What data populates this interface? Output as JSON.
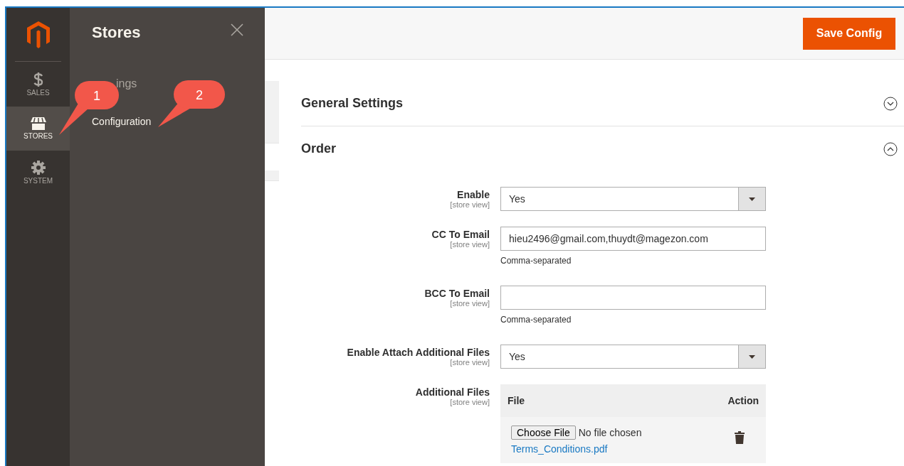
{
  "nav": {
    "items": [
      {
        "kind": "dollar",
        "label": "SALES",
        "selected": false
      },
      {
        "kind": "store",
        "label": "STORES",
        "selected": true
      },
      {
        "kind": "gear",
        "label": "SYSTEM",
        "selected": false
      }
    ]
  },
  "flyout": {
    "title": "Stores",
    "items": [
      "ings",
      "Configuration"
    ]
  },
  "callouts": [
    "1",
    "2"
  ],
  "toolbar": {
    "button": "Save Config"
  },
  "sections": [
    {
      "title": "General Settings",
      "expanded": false
    },
    {
      "title": "Order",
      "expanded": true
    }
  ],
  "fields": [
    {
      "kind": "select",
      "label": "Enable",
      "scope": "[store view]",
      "value": "Yes"
    },
    {
      "kind": "text",
      "label": "CC To Email",
      "scope": "[store view]",
      "value": "hieu2496@gmail.com,thuydt@magezon.com",
      "note": "Comma-separated"
    },
    {
      "kind": "text",
      "label": "BCC To Email",
      "scope": "[store view]",
      "note": "Comma-separated"
    },
    {
      "kind": "select",
      "label": "Enable Attach Additional Files",
      "scope": "[store view]",
      "value": "Yes"
    },
    {
      "kind": "files",
      "label": "Additional Files",
      "scope": "[store view]",
      "columns": [
        "File",
        "Action"
      ],
      "rows": [
        {
          "button": "Choose File",
          "status": "No file chosen",
          "link": "Terms_Conditions.pdf"
        }
      ]
    }
  ]
}
